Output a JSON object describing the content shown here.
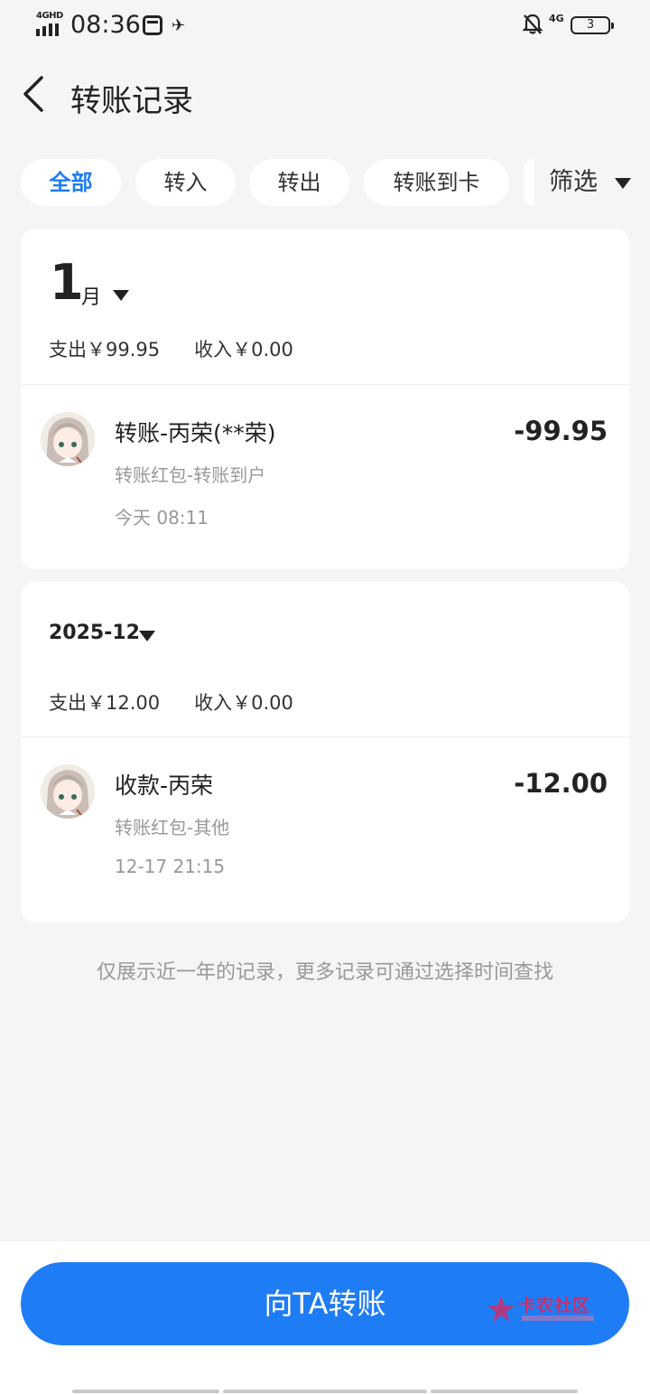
{
  "status_bar": {
    "network_label": "4GHD",
    "time": "08:36",
    "mobile_data_label": "4G",
    "battery": "3"
  },
  "header": {
    "title": "转账记录"
  },
  "tabs": [
    {
      "label": "全部",
      "active": true
    },
    {
      "label": "转入",
      "active": false
    },
    {
      "label": "转出",
      "active": false
    },
    {
      "label": "转账到卡",
      "active": false
    }
  ],
  "filter_label": "筛选",
  "groups": [
    {
      "month_number": "1",
      "month_unit": "月",
      "expense": "支出￥99.95",
      "income": "收入￥0.00",
      "records": [
        {
          "title": "转账-丙荣(**荣)",
          "amount": "-99.95",
          "subtitle": "转账红包-转账到户",
          "time": "今天 08:11"
        }
      ]
    },
    {
      "month_label": "2025-12",
      "expense": "支出￥12.00",
      "income": "收入￥0.00",
      "records": [
        {
          "title": "收款-丙荣",
          "amount": "-12.00",
          "subtitle": "转账红包-其他",
          "time": "12-17 21:15"
        }
      ]
    }
  ],
  "notice": "仅展示近一年的记录，更多记录可通过选择时间查找",
  "transfer_button": "向TA转账",
  "watermark": "卡农社区",
  "colors": {
    "accent": "#1e7cf5",
    "background": "#f5f5f5",
    "card": "#ffffff",
    "watermark": "#c8306e"
  }
}
